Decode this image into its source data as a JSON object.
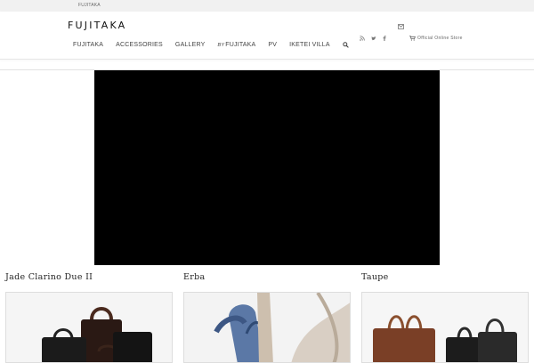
{
  "topbar": {
    "label": "FUJITAKA"
  },
  "header": {
    "logo": "FUJITAKA",
    "nav": [
      {
        "label": "FUJITAKA"
      },
      {
        "label": "ACCESSORIES"
      },
      {
        "label": "GALLERY"
      },
      {
        "prefix": "BY",
        "label": "FUJITAKA"
      },
      {
        "label": "PV"
      },
      {
        "label": "IKETEI VILLA"
      }
    ],
    "store_label": "Official Online Store",
    "icons": [
      "envelope-icon",
      "rss-icon",
      "twitter-icon",
      "facebook-icon",
      "cart-icon",
      "search-icon"
    ]
  },
  "products": [
    {
      "title": "Jade Clarino Due II"
    },
    {
      "title": "Erba"
    },
    {
      "title": "Taupe"
    }
  ],
  "colors": {
    "topbar": "#f1f1f1",
    "video": "#000000",
    "text": "#333333"
  }
}
